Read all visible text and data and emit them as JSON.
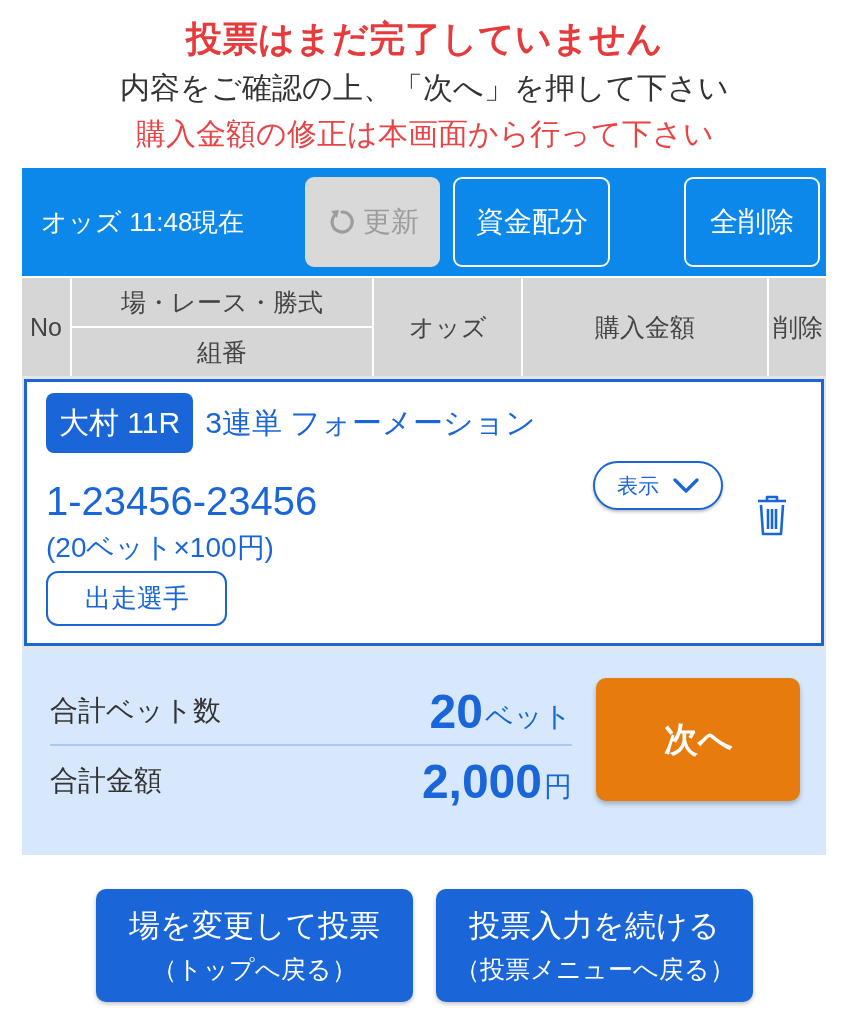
{
  "notice": {
    "title": "投票はまだ完了していません",
    "instruction": "内容をご確認の上、「次へ」を押して下さい",
    "warning": "購入金額の修正は本画面から行って下さい"
  },
  "toolbar": {
    "odds_time": "オッズ 11:48現在",
    "buttons": [
      {
        "label": "更新",
        "kind": "refresh",
        "disabled": true
      },
      {
        "label": "資金配分",
        "kind": "plain",
        "disabled": false
      },
      {
        "label": "全削除",
        "kind": "plain",
        "disabled": false
      }
    ]
  },
  "table": {
    "columns": [
      {
        "label": "No"
      },
      {
        "label": "場・レース・勝式",
        "sub_label": "組番"
      },
      {
        "label": "オッズ"
      },
      {
        "label": "購入金額"
      },
      {
        "label": "削除"
      }
    ]
  },
  "bets": [
    {
      "venue_race": "大村 11R",
      "bet_type": "3連単 フォーメーション",
      "combination": "1-23456-23456",
      "detail": "(20ベット×100円)",
      "toggle_label": "表示",
      "expanded": false,
      "players_button": "出走選手"
    }
  ],
  "summary": {
    "rows": [
      {
        "label": "合計ベット数",
        "value": "20",
        "unit": "ベット"
      },
      {
        "label": "合計金額",
        "value": "2,000",
        "unit": "円"
      }
    ],
    "next_button": "次へ"
  },
  "footer_buttons": [
    {
      "label": "場を変更して投票",
      "sub_label": "（トップへ戻る）"
    },
    {
      "label": "投票入力を続ける",
      "sub_label": "（投票メニューへ戻る）"
    }
  ]
}
